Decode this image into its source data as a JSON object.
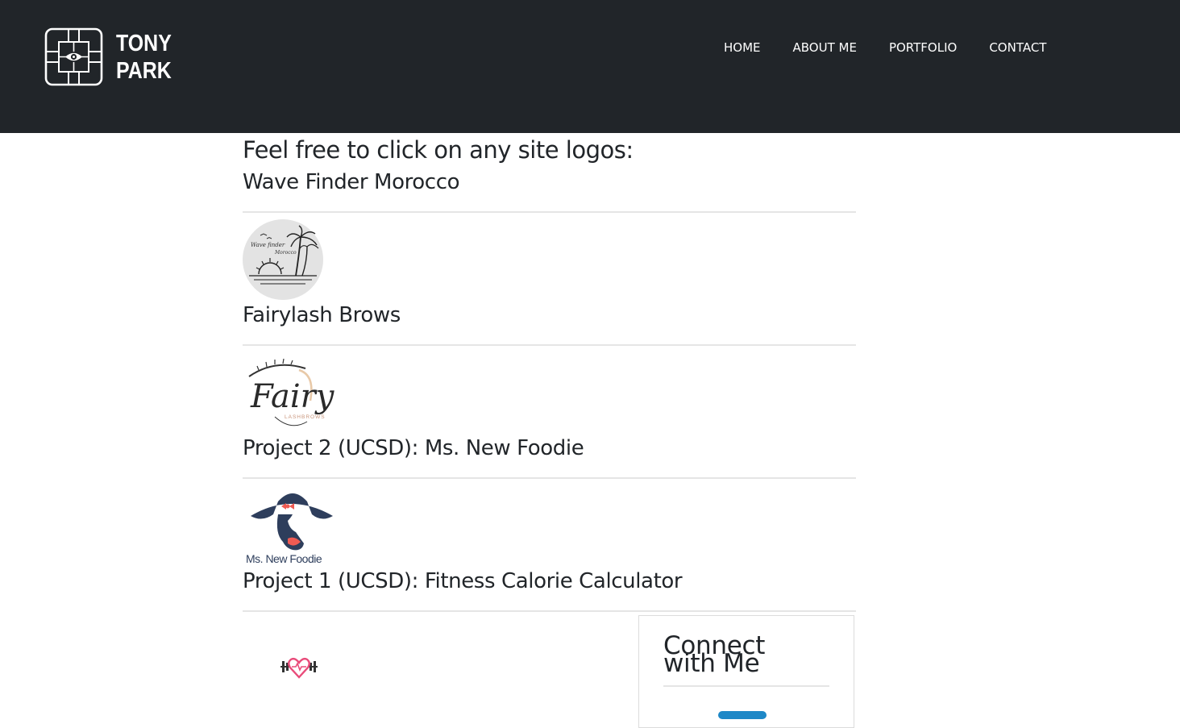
{
  "brand": {
    "line1": "TONY",
    "line2": "PARK",
    "logo_icon": "eye-emblem-icon"
  },
  "nav": {
    "items": [
      {
        "label": "HOME"
      },
      {
        "label": "ABOUT ME"
      },
      {
        "label": "PORTFOLIO"
      },
      {
        "label": "CONTACT"
      }
    ]
  },
  "main": {
    "lead": "Feel free to click on any site logos:",
    "projects": [
      {
        "title": "Wave Finder Morocco",
        "logo": "wave-finder-morocco-logo",
        "logo_text": [
          "Wave finder",
          "Morocco"
        ]
      },
      {
        "title": "Fairylash Brows",
        "logo": "fairylash-brows-logo",
        "logo_text": [
          "Fairy",
          "LASHBROWS"
        ]
      },
      {
        "title": "Project 2 (UCSD): Ms. New Foodie",
        "logo": "ms-new-foodie-logo",
        "logo_text": [
          "Ms. New Foodie"
        ]
      },
      {
        "title": "Project 1 (UCSD): Fitness Calorie Calculator",
        "logo": "fitness-heart-dumbbell-icon"
      }
    ]
  },
  "sidebar": {
    "title": "Connect with Me"
  },
  "colors": {
    "navbar_bg": "#212529",
    "nav_text": "#ffffff",
    "body_text": "#212529",
    "divider": "#e5e5e5",
    "foodie_navy": "#2e3e5c",
    "foodie_coral": "#ef5b53",
    "fitness_pink": "#e94b7a"
  }
}
